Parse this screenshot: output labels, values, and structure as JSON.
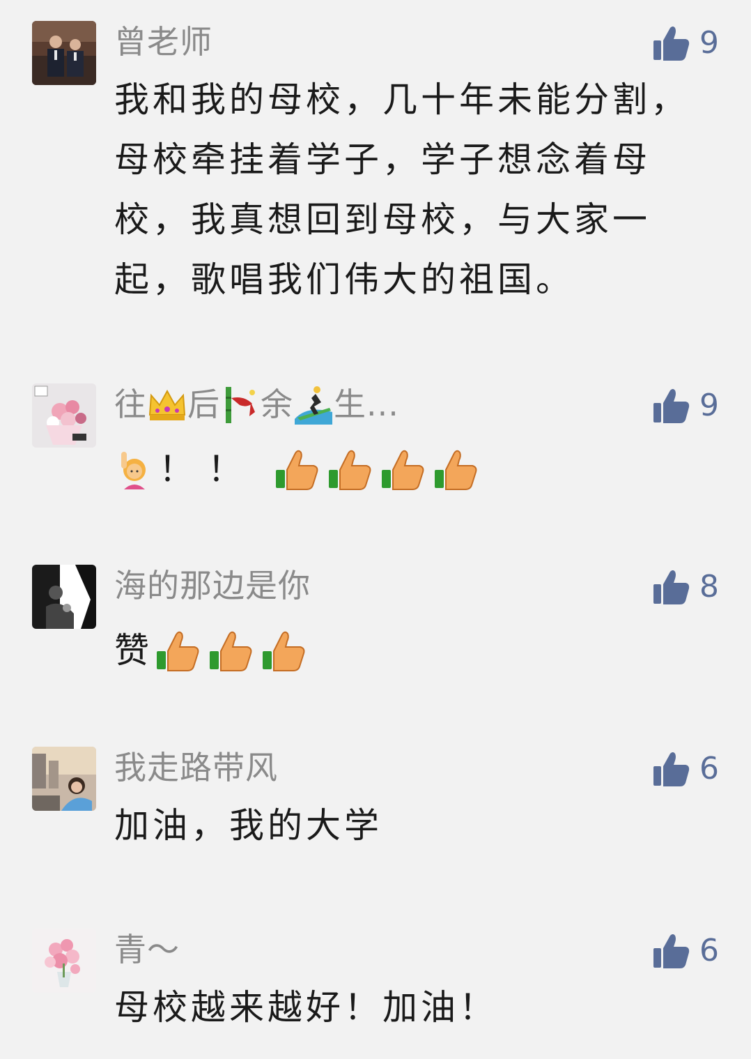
{
  "comments": [
    {
      "nickname": "曾老师",
      "likes": "9",
      "text": "我和我的母校，几十年未能分割，母校牵挂着学子，学子想念着母校，我真想回到母校，与大家一起，歌唱我们伟大的祖国。",
      "avatar_icon": "photo-two-men-icon"
    },
    {
      "nickname_parts": [
        "往",
        "后",
        "余",
        "生..."
      ],
      "nickname_icons": [
        "crown-emoji-icon",
        "bamboo-emoji-icon",
        "surfer-emoji-icon"
      ],
      "likes": "9",
      "text_prefix": "",
      "text_marks": "！！",
      "thumbs_count": 4,
      "avatar_icon": "photo-flowers-icon"
    },
    {
      "nickname": "海的那边是你",
      "likes": "8",
      "text": "赞",
      "thumbs_count": 3,
      "avatar_icon": "photo-silhouette-icon"
    },
    {
      "nickname": "我走路带风",
      "likes": "6",
      "text": "加油，我的大学",
      "avatar_icon": "photo-girl-street-icon"
    },
    {
      "nickname": "青～",
      "likes": "6",
      "text": "母校越来越好！加油！",
      "avatar_icon": "photo-pink-flowers-icon"
    }
  ],
  "colors": {
    "background": "#f2f2f2",
    "nickname": "#8a8a8a",
    "like": "#596d98",
    "text": "#1a1a1a"
  }
}
